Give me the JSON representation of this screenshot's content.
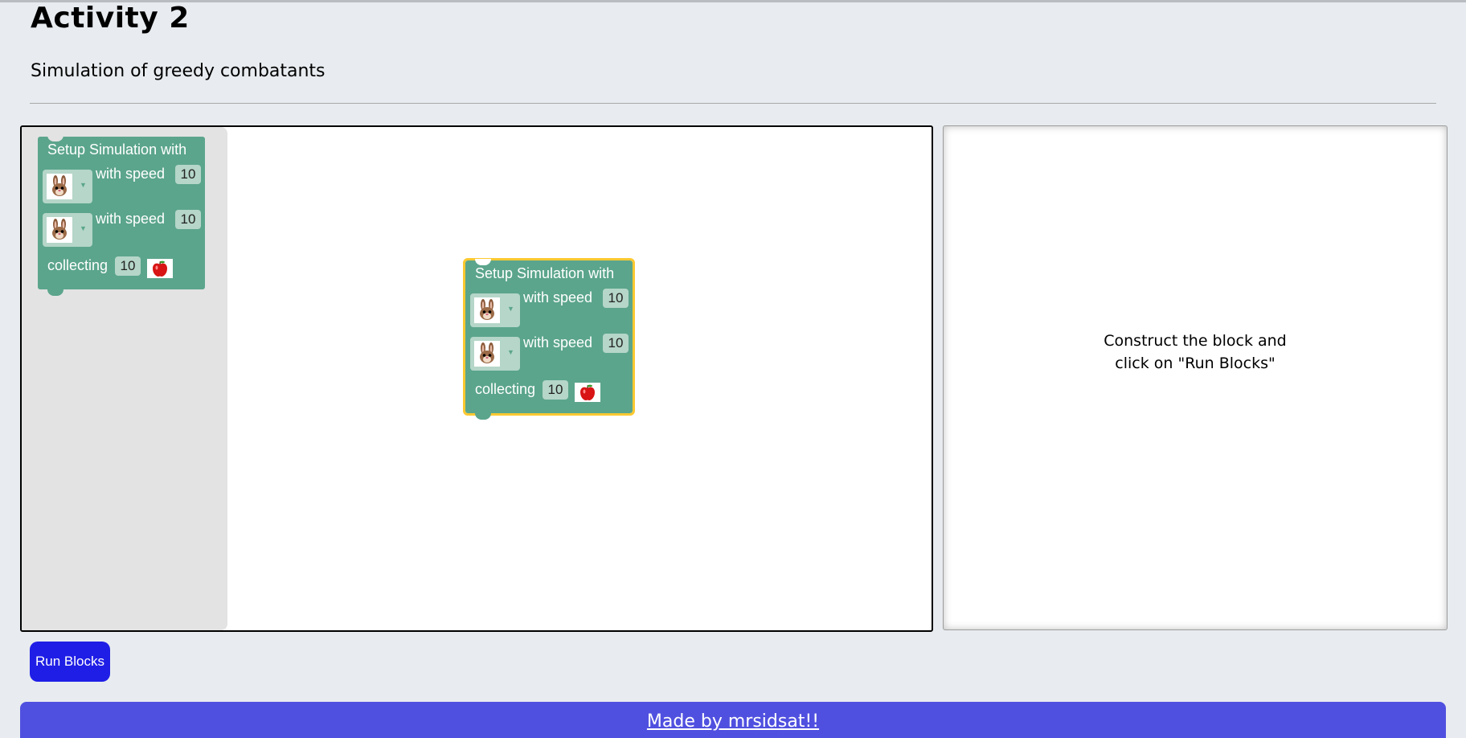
{
  "page": {
    "title": "Activity 2",
    "subtitle": "Simulation of greedy combatants"
  },
  "block": {
    "header": "Setup Simulation with",
    "combatant1_icon": "rabbit-icon",
    "combatant1_label": "with speed",
    "combatant1_speed": "10",
    "combatant2_icon": "rabbit-icon",
    "combatant2_label": "with speed",
    "combatant2_speed": "10",
    "collecting_label": "collecting",
    "collecting_count": "10",
    "collecting_icon": "apple-icon",
    "color": "#5ba58c",
    "selected_outline": "#fcc931"
  },
  "output": {
    "message_line1": "Construct the block and",
    "message_line2": "click on \"Run Blocks\""
  },
  "controls": {
    "run_label": "Run Blocks",
    "run_color": "#1f1ee6"
  },
  "footer": {
    "link_text": "Made by mrsidsat!!",
    "color": "#5050e0"
  }
}
